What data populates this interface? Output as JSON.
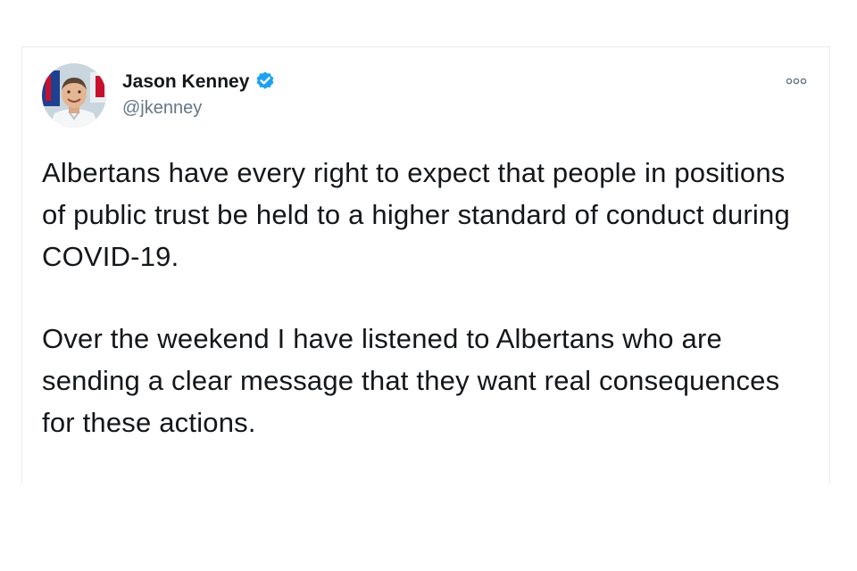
{
  "tweet": {
    "author": {
      "display_name": "Jason Kenney",
      "handle": "@jkenney",
      "verified": true
    },
    "more_menu_icon": "more-options-icon",
    "paragraphs": [
      "Albertans have every right to expect that people in positions of public trust be held to a higher standard of conduct during COVID-19.",
      "Over the weekend I have listened to Albertans who are sending a clear message that they want real consequences for these actions."
    ]
  },
  "colors": {
    "verified_badge": "#1da1f2",
    "handle": "#657786",
    "text": "#14171a",
    "border": "#e6ecf0"
  }
}
